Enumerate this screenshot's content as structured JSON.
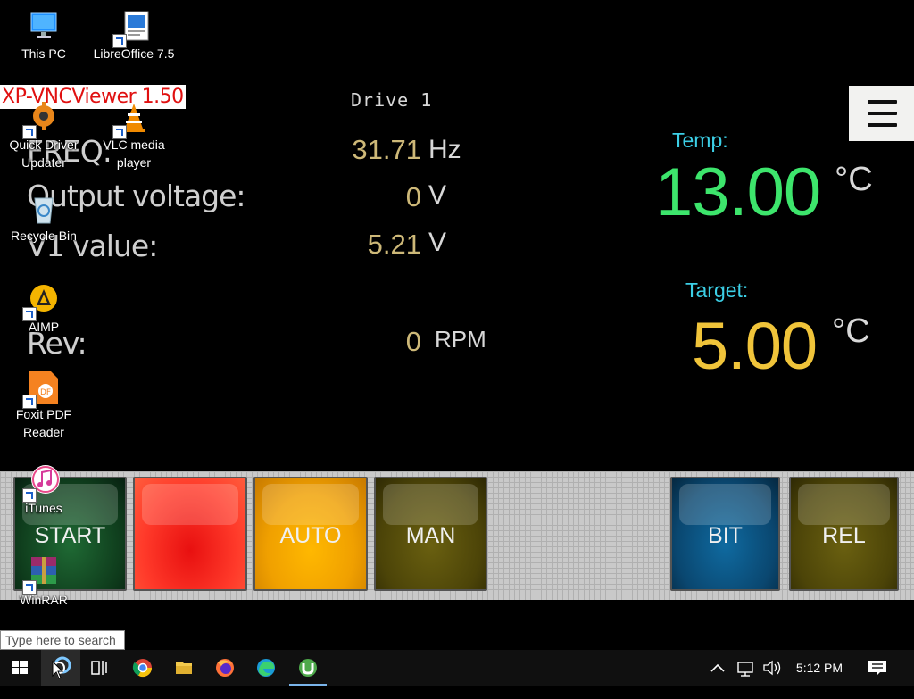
{
  "vnc_app": {
    "title": "XP-VNCViewer 1.50",
    "drive_label": "Drive 1",
    "params": [
      {
        "label": "FREQ:",
        "value": "31.71",
        "unit": "Hz"
      },
      {
        "label": "Output voltage:",
        "value": "0",
        "unit": "V"
      },
      {
        "label": "V1 value:",
        "value": "5.21",
        "unit": "V"
      },
      {
        "label": "Rev:",
        "value": "0",
        "unit": "RPM"
      }
    ],
    "temp": {
      "label": "Temp:",
      "value": "13.00",
      "unit": "°C"
    },
    "target": {
      "label": "Target:",
      "value": "5.00",
      "unit": "°C"
    },
    "controls": [
      {
        "label": "START",
        "color": "#1f6a34"
      },
      {
        "label": "",
        "color": "#e81010"
      },
      {
        "label": "AUTO",
        "color": "#ffb800"
      },
      {
        "label": "MAN",
        "color": "#6a6010"
      },
      {
        "label": "BIT",
        "color": "#0f6aa0"
      },
      {
        "label": "REL",
        "color": "#6a6010"
      }
    ]
  },
  "desktop_icons": [
    {
      "label": "This PC",
      "icon": "computer-icon"
    },
    {
      "label": "LibreOffice 7.5",
      "icon": "libreoffice-icon"
    },
    {
      "label": "Quick Driver Updater",
      "icon": "driver-updater-icon"
    },
    {
      "label": "VLC media player",
      "icon": "vlc-icon"
    },
    {
      "label": "Recycle Bin",
      "icon": "recycle-bin-icon"
    },
    {
      "label": "AIMP",
      "icon": "aimp-icon"
    },
    {
      "label": "Foxit PDF Reader",
      "icon": "foxit-icon"
    },
    {
      "label": "iTunes",
      "icon": "itunes-icon"
    },
    {
      "label": "WinRAR",
      "icon": "winrar-icon"
    }
  ],
  "search": {
    "placeholder": "Type here to search"
  },
  "taskbar": {
    "pinned": [
      "windows-start-icon",
      "search-circle-icon",
      "task-view-icon",
      "chrome-icon",
      "file-explorer-icon",
      "firefox-icon",
      "edge-icon",
      "utorrent-icon"
    ],
    "clock": "5:12 PM"
  }
}
